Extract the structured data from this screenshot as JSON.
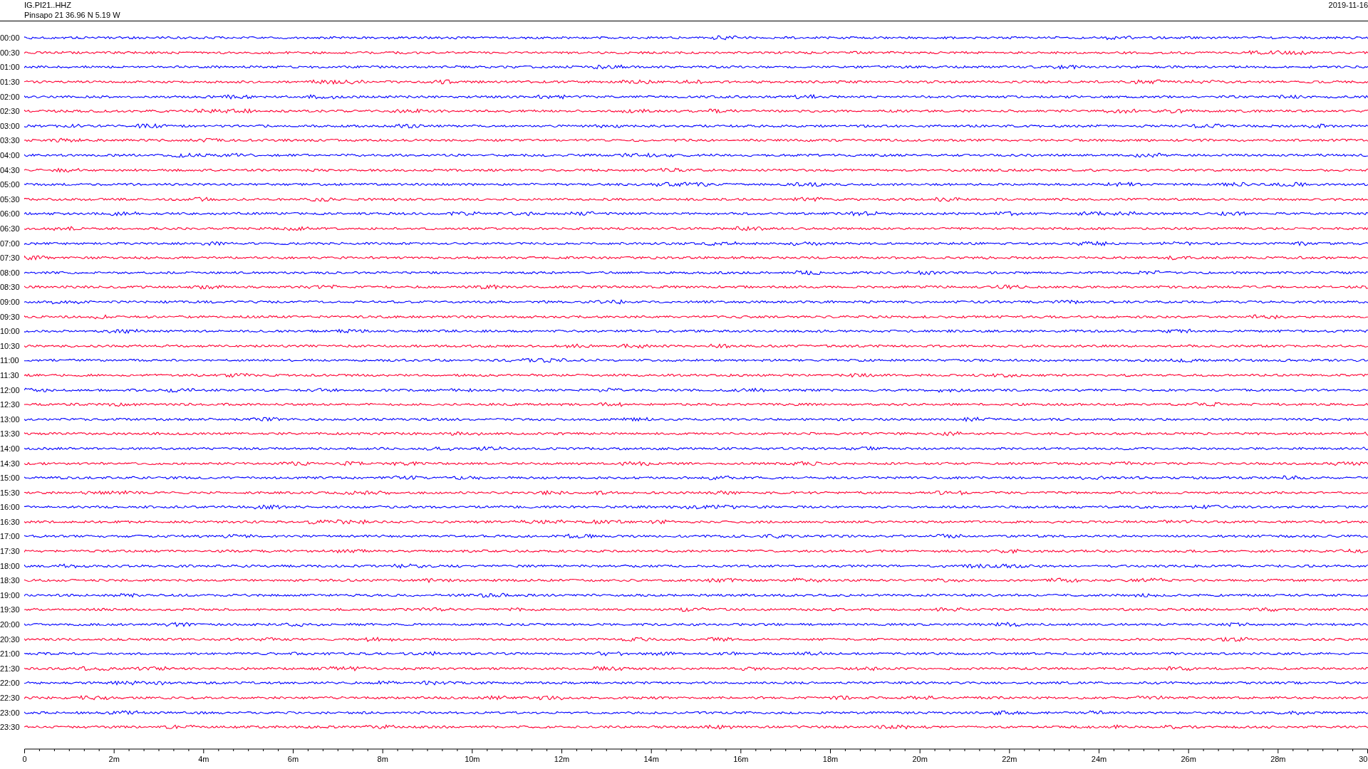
{
  "header": {
    "station": "IG.PI21..HHZ",
    "location": "Pinsapo 21  36.96 N 5.19 W",
    "date": "2019-11-16"
  },
  "traces": [
    {
      "label": "00:00",
      "color": "#0000ff"
    },
    {
      "label": "00:30",
      "color": "#ff0033"
    },
    {
      "label": "01:00",
      "color": "#0000ff"
    },
    {
      "label": "01:30",
      "color": "#ff0033"
    },
    {
      "label": "02:00",
      "color": "#0000ff"
    },
    {
      "label": "02:30",
      "color": "#ff0033"
    },
    {
      "label": "03:00",
      "color": "#0000ff"
    },
    {
      "label": "03:30",
      "color": "#ff0033"
    },
    {
      "label": "04:00",
      "color": "#0000ff"
    },
    {
      "label": "04:30",
      "color": "#ff0033"
    },
    {
      "label": "05:00",
      "color": "#0000ff"
    },
    {
      "label": "05:30",
      "color": "#ff0033"
    },
    {
      "label": "06:00",
      "color": "#0000ff"
    },
    {
      "label": "06:30",
      "color": "#ff0033"
    },
    {
      "label": "07:00",
      "color": "#0000ff"
    },
    {
      "label": "07:30",
      "color": "#ff0033"
    },
    {
      "label": "08:00",
      "color": "#0000ff"
    },
    {
      "label": "08:30",
      "color": "#ff0033"
    },
    {
      "label": "09:00",
      "color": "#0000ff"
    },
    {
      "label": "09:30",
      "color": "#ff0033"
    },
    {
      "label": "10:00",
      "color": "#0000ff"
    },
    {
      "label": "10:30",
      "color": "#ff0033"
    },
    {
      "label": "11:00",
      "color": "#0000ff"
    },
    {
      "label": "11:30",
      "color": "#ff0033"
    },
    {
      "label": "12:00",
      "color": "#0000ff"
    },
    {
      "label": "12:30",
      "color": "#ff0033"
    },
    {
      "label": "13:00",
      "color": "#0000ff"
    },
    {
      "label": "13:30",
      "color": "#ff0033"
    },
    {
      "label": "14:00",
      "color": "#0000ff"
    },
    {
      "label": "14:30",
      "color": "#ff0033"
    },
    {
      "label": "15:00",
      "color": "#0000ff"
    },
    {
      "label": "15:30",
      "color": "#ff0033"
    },
    {
      "label": "16:00",
      "color": "#0000ff"
    },
    {
      "label": "16:30",
      "color": "#ff0033"
    },
    {
      "label": "17:00",
      "color": "#0000ff"
    },
    {
      "label": "17:30",
      "color": "#ff0033"
    },
    {
      "label": "18:00",
      "color": "#0000ff"
    },
    {
      "label": "18:30",
      "color": "#ff0033"
    },
    {
      "label": "19:00",
      "color": "#0000ff"
    },
    {
      "label": "19:30",
      "color": "#ff0033"
    },
    {
      "label": "20:00",
      "color": "#0000ff"
    },
    {
      "label": "20:30",
      "color": "#ff0033"
    },
    {
      "label": "21:00",
      "color": "#0000ff"
    },
    {
      "label": "21:30",
      "color": "#ff0033"
    },
    {
      "label": "22:00",
      "color": "#0000ff"
    },
    {
      "label": "22:30",
      "color": "#ff0033"
    },
    {
      "label": "23:00",
      "color": "#0000ff"
    },
    {
      "label": "23:30",
      "color": "#ff0033"
    }
  ],
  "time_axis": {
    "labels": [
      "0",
      "2m",
      "4m",
      "6m",
      "8m",
      "10m",
      "12m",
      "14m",
      "16m",
      "18m",
      "20m",
      "22m",
      "24m",
      "26m",
      "28m",
      "30"
    ]
  }
}
